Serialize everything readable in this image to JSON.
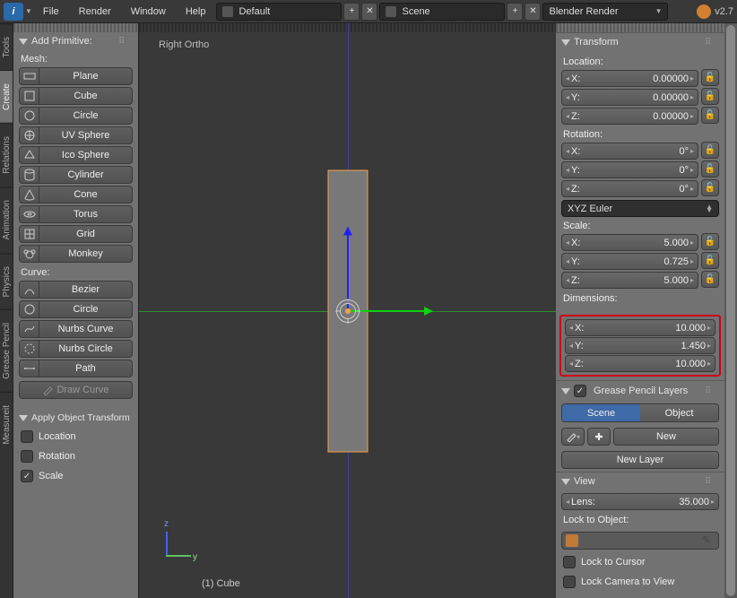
{
  "menubar": {
    "items": [
      "File",
      "Render",
      "Window",
      "Help"
    ],
    "layout_dropdown": "Default",
    "scene_dropdown": "Scene",
    "renderer_dropdown": "Blender Render",
    "version": "v2.7"
  },
  "vtabs": [
    "Tools",
    "Create",
    "Relations",
    "Animation",
    "Physics",
    "Grease Pencil",
    "Measureit"
  ],
  "tool_panel": {
    "header": "Add Primitive:",
    "mesh_label": "Mesh:",
    "mesh": [
      "Plane",
      "Cube",
      "Circle",
      "UV Sphere",
      "Ico Sphere",
      "Cylinder",
      "Cone",
      "Torus",
      "Grid",
      "Monkey"
    ],
    "curve_label": "Curve:",
    "curve": [
      "Bezier",
      "Circle",
      "Nurbs Curve",
      "Nurbs Circle",
      "Path"
    ],
    "draw_curve": "Draw Curve",
    "operator_header": "Apply Object Transform",
    "op_location": "Location",
    "op_rotation": "Rotation",
    "op_scale": "Scale"
  },
  "viewport": {
    "label": "Right Ortho",
    "footer": "(1) Cube",
    "axis_z": "z",
    "axis_y": "y"
  },
  "transform": {
    "header": "Transform",
    "location_label": "Location:",
    "location": {
      "X": "0.00000",
      "Y": "0.00000",
      "Z": "0.00000"
    },
    "rotation_label": "Rotation:",
    "rotation": {
      "X": "0°",
      "Y": "0°",
      "Z": "0°"
    },
    "rotation_mode": "XYZ Euler",
    "scale_label": "Scale:",
    "scale": {
      "X": "5.000",
      "Y": "0.725",
      "Z": "5.000"
    },
    "dimensions_label": "Dimensions:",
    "dimensions": {
      "X": "10.000",
      "Y": "1.450",
      "Z": "10.000"
    }
  },
  "grease": {
    "header": "Grease Pencil Layers",
    "scene_btn": "Scene",
    "object_btn": "Object",
    "new_btn": "New",
    "new_layer": "New Layer"
  },
  "view": {
    "header": "View",
    "lens_label": "Lens:",
    "lens_value": "35.000",
    "lock_label": "Lock to Object:",
    "lock_cursor": "Lock to Cursor",
    "lock_camera": "Lock Camera to View"
  }
}
